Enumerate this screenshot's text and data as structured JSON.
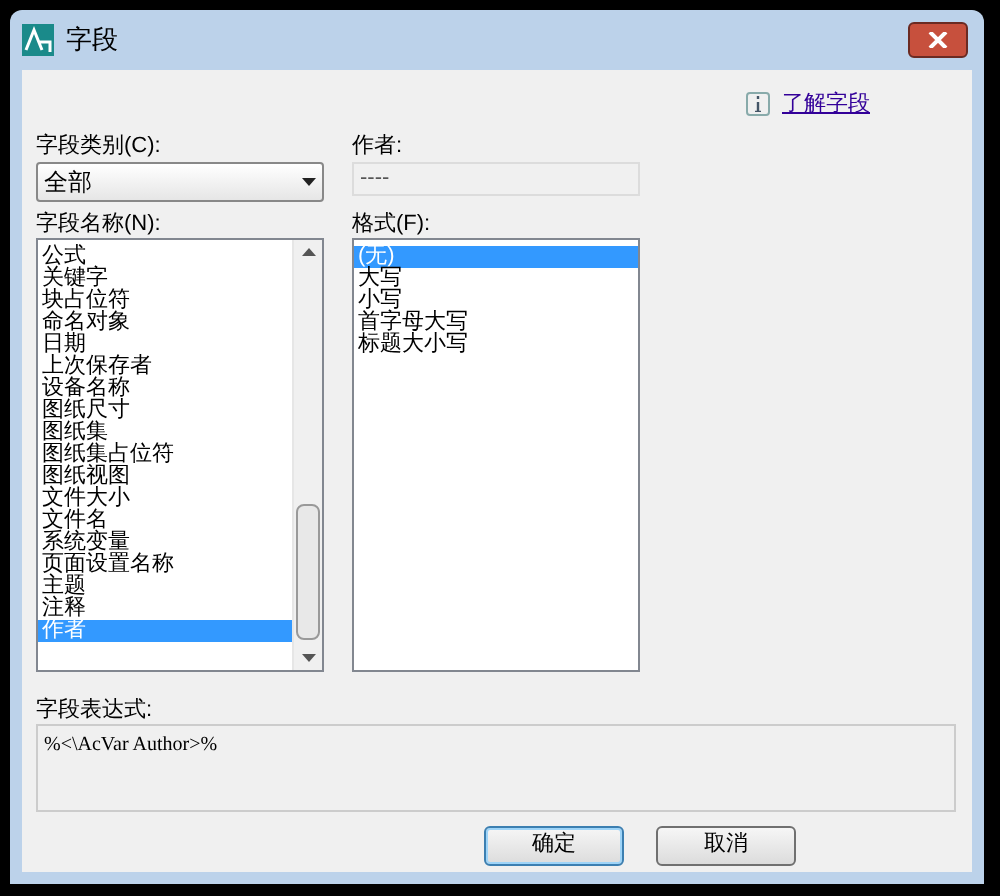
{
  "window": {
    "title": "字段"
  },
  "help_link": {
    "label": "了解字段"
  },
  "category": {
    "label": "字段类别(C):",
    "value": "全部"
  },
  "author": {
    "label": "作者:",
    "value": "----"
  },
  "field_names": {
    "label": "字段名称(N):",
    "items": [
      {
        "label": "公式",
        "selected": false
      },
      {
        "label": "关键字",
        "selected": false
      },
      {
        "label": "块占位符",
        "selected": false
      },
      {
        "label": "命名对象",
        "selected": false
      },
      {
        "label": "日期",
        "selected": false
      },
      {
        "label": "上次保存者",
        "selected": false
      },
      {
        "label": "设备名称",
        "selected": false
      },
      {
        "label": "图纸尺寸",
        "selected": false
      },
      {
        "label": "图纸集",
        "selected": false
      },
      {
        "label": "图纸集占位符",
        "selected": false
      },
      {
        "label": "图纸视图",
        "selected": false
      },
      {
        "label": "文件大小",
        "selected": false
      },
      {
        "label": "文件名",
        "selected": false
      },
      {
        "label": "系统变量",
        "selected": false
      },
      {
        "label": "页面设置名称",
        "selected": false
      },
      {
        "label": "主题",
        "selected": false
      },
      {
        "label": "注释",
        "selected": false
      },
      {
        "label": "作者",
        "selected": true
      }
    ]
  },
  "format": {
    "label": "格式(F):",
    "items": [
      {
        "label": "(无)",
        "selected": true
      },
      {
        "label": "大写",
        "selected": false
      },
      {
        "label": "小写",
        "selected": false
      },
      {
        "label": "首字母大写",
        "selected": false
      },
      {
        "label": "标题大小写",
        "selected": false
      }
    ]
  },
  "expression": {
    "label": "字段表达式:",
    "value": "%<\\AcVar Author>%"
  },
  "buttons": [
    {
      "label": "确定",
      "kind": "default"
    },
    {
      "label": "取消",
      "kind": "normal"
    }
  ]
}
